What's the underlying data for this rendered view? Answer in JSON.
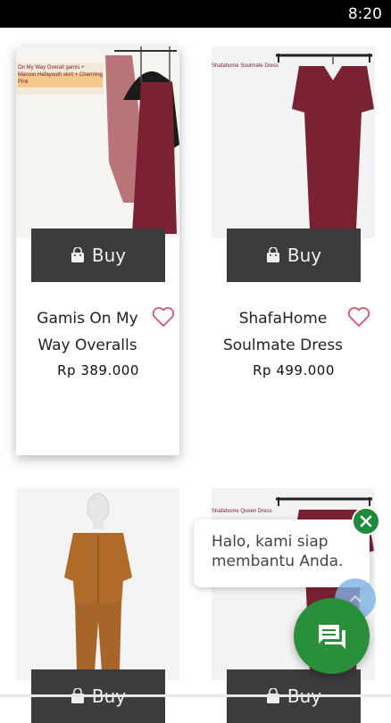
{
  "status_bar": {
    "time": "8:20"
  },
  "products": [
    {
      "name_line1": "Gamis On My",
      "name_line2": "Way Overalls",
      "price": "Rp 389.000",
      "buy_label": "Buy",
      "image_caption": "On My Way Overall gamis + Maroon Hafayouth skirt + Charming Pink"
    },
    {
      "name_line1": "ShafaHome",
      "name_line2": "Soulmate Dress",
      "price": "Rp 499.000",
      "buy_label": "Buy",
      "image_caption": "Shafahome Soulmate Dress"
    },
    {
      "buy_label": "Buy"
    },
    {
      "buy_label": "Buy",
      "image_caption": "Shafahome Queen Dress"
    }
  ],
  "chat": {
    "message": "Halo, kami siap membantu Anda."
  },
  "colors": {
    "buy_button": "#3c3c3c",
    "chat_green": "#2a8f3b",
    "maroon": "#7a2233",
    "brown": "#b06a2a"
  },
  "icons": [
    "shopping-bag-icon",
    "heart-icon",
    "close-icon",
    "chat-icon",
    "arrow-up-icon"
  ]
}
